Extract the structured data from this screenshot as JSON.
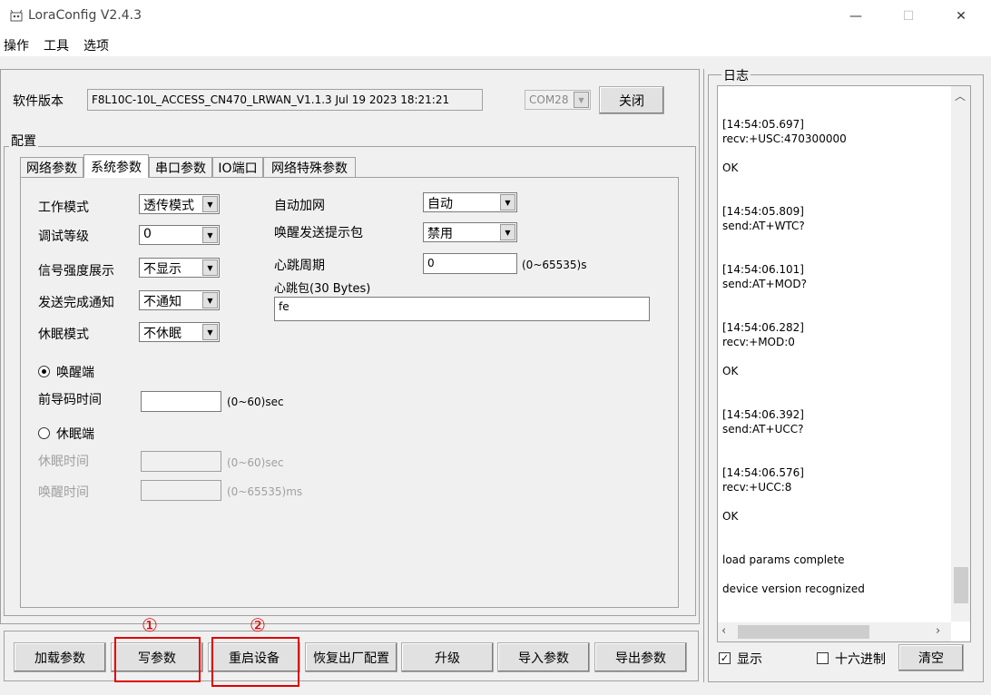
{
  "window": {
    "title": "LoraConfig V2.4.3",
    "minimize": "—",
    "maximize": "☐",
    "close": "✕"
  },
  "menu": [
    "操作",
    "工具",
    "选项"
  ],
  "version": {
    "label": "软件版本",
    "value": "F8L10C-10L_ACCESS_CN470_LRWAN_V1.1.3 Jul 19 2023 18:21:21",
    "port": "COM28",
    "close_button": "关闭"
  },
  "config_title": "配置",
  "tabs": [
    "网络参数",
    "系统参数",
    "串口参数",
    "IO端口",
    "网络特殊参数"
  ],
  "system": {
    "work_mode": {
      "label": "工作模式",
      "value": "透传模式"
    },
    "debug_level": {
      "label": "调试等级",
      "value": "0"
    },
    "signal_display": {
      "label": "信号强度展示",
      "value": "不显示"
    },
    "send_notify": {
      "label": "发送完成通知",
      "value": "不通知"
    },
    "sleep_mode": {
      "label": "休眠模式",
      "value": "不休眠"
    },
    "auto_join": {
      "label": "自动加网",
      "value": "自动"
    },
    "wake_packet": {
      "label": "唤醒发送提示包",
      "value": "禁用"
    },
    "heartbeat_period": {
      "label": "心跳周期",
      "value": "0",
      "range": "(0~65535)s"
    },
    "heartbeat_packet": {
      "label": "心跳包(30 Bytes)",
      "value": "fe"
    },
    "wake_end": {
      "label": "唤醒端",
      "checked": true
    },
    "preamble_time": {
      "label": "前导码时间",
      "value": "",
      "range": "(0~60)sec"
    },
    "sleep_end": {
      "label": "休眠端",
      "checked": false
    },
    "sleep_time": {
      "label": "休眠时间",
      "value": "",
      "range": "(0~60)sec"
    },
    "wake_time": {
      "label": "唤醒时间",
      "value": "",
      "range": "(0~65535)ms"
    }
  },
  "bottom_buttons": [
    "加载参数",
    "写参数",
    "重启设备",
    "恢复出厂配置",
    "升级",
    "导入参数",
    "导出参数"
  ],
  "annotations": [
    "①",
    "②"
  ],
  "log": {
    "title": "日志",
    "lines": [
      "[14:54:05.697]",
      "recv:+USC:470300000",
      "OK",
      "[14:54:05.809]",
      "send:AT+WTC?",
      "[14:54:06.101]",
      "send:AT+MOD?",
      "[14:54:06.282]",
      "recv:+MOD:0",
      "OK",
      "[14:54:06.392]",
      "send:AT+UCC?",
      "[14:54:06.576]",
      "recv:+UCC:8",
      "OK",
      "load params complete",
      "device version recognized"
    ],
    "display_label": "显示",
    "display_checked": true,
    "hex_label": "十六进制",
    "hex_checked": false,
    "clear_button": "清空"
  },
  "colors": {
    "annotation": "#e00000",
    "window_bg": "#f0f0f0"
  }
}
